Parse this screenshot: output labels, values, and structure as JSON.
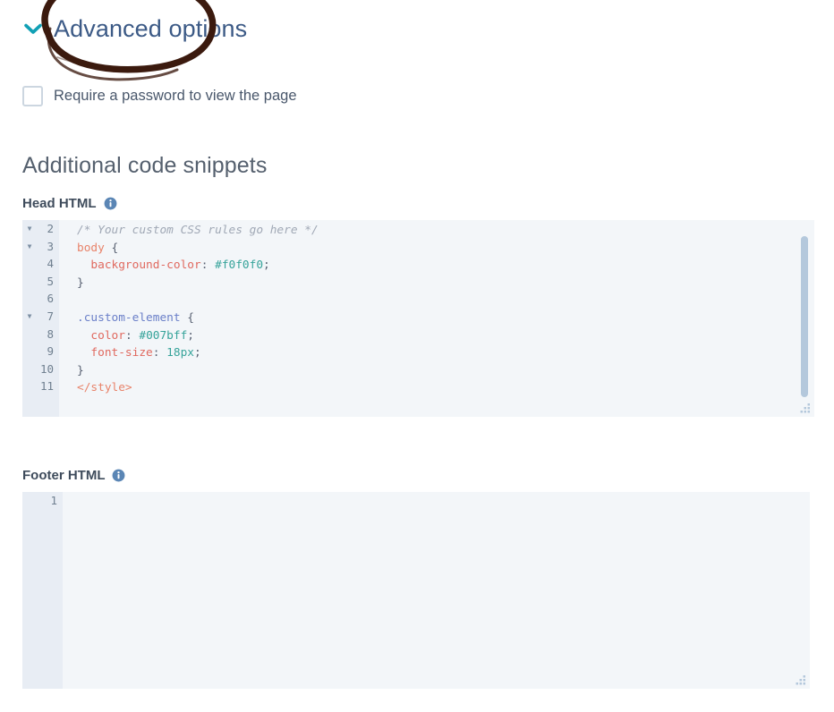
{
  "advanced_section": {
    "chevron_icon": "chevron-down-icon",
    "title": "Advanced options",
    "title_color": "#3c5a86",
    "chevron_color": "#11a0b5",
    "annotation": {
      "icon": "hand-drawn-circle-annotation",
      "color": "#3b1a0e"
    },
    "checkbox": {
      "label": "Require a password to view the page",
      "checked": false
    }
  },
  "snippets_section": {
    "title": "Additional code snippets",
    "fields": [
      {
        "label": "Head HTML",
        "info_icon": "info-circle-icon",
        "editor": {
          "first_line_number": 2,
          "has_scrollbar": true,
          "has_resize_grip": true,
          "lines": [
            {
              "number": 2,
              "foldable": true,
              "tokens": [
                {
                  "t": "comment",
                  "s": "/* Your custom CSS rules go here */"
                }
              ]
            },
            {
              "number": 3,
              "foldable": true,
              "tokens": [
                {
                  "t": "tag",
                  "s": "body"
                },
                {
                  "t": "punct",
                  "s": " {"
                }
              ]
            },
            {
              "number": 4,
              "foldable": false,
              "tokens": [
                {
                  "t": "prop",
                  "s": "  background-color"
                },
                {
                  "t": "punct",
                  "s": ": "
                },
                {
                  "t": "value",
                  "s": "#f0f0f0"
                },
                {
                  "t": "punct",
                  "s": ";"
                }
              ]
            },
            {
              "number": 5,
              "foldable": false,
              "tokens": [
                {
                  "t": "punct",
                  "s": "}"
                }
              ]
            },
            {
              "number": 6,
              "foldable": false,
              "tokens": [
                {
                  "t": "punct",
                  "s": ""
                }
              ]
            },
            {
              "number": 7,
              "foldable": true,
              "tokens": [
                {
                  "t": "selector",
                  "s": ".custom-element"
                },
                {
                  "t": "punct",
                  "s": " {"
                }
              ]
            },
            {
              "number": 8,
              "foldable": false,
              "tokens": [
                {
                  "t": "prop",
                  "s": "  color"
                },
                {
                  "t": "punct",
                  "s": ": "
                },
                {
                  "t": "value",
                  "s": "#007bff"
                },
                {
                  "t": "punct",
                  "s": ";"
                }
              ]
            },
            {
              "number": 9,
              "foldable": false,
              "tokens": [
                {
                  "t": "prop",
                  "s": "  font-size"
                },
                {
                  "t": "punct",
                  "s": ": "
                },
                {
                  "t": "value",
                  "s": "18px"
                },
                {
                  "t": "punct",
                  "s": ";"
                }
              ]
            },
            {
              "number": 10,
              "foldable": false,
              "tokens": [
                {
                  "t": "punct",
                  "s": "}"
                }
              ]
            },
            {
              "number": 11,
              "foldable": false,
              "tokens": [
                {
                  "t": "tag",
                  "s": "</style>"
                }
              ]
            }
          ]
        }
      },
      {
        "label": "Footer HTML",
        "info_icon": "info-circle-icon",
        "editor": {
          "first_line_number": 1,
          "has_scrollbar": false,
          "has_resize_grip": true,
          "lines": [
            {
              "number": 1,
              "foldable": false,
              "tokens": [
                {
                  "t": "punct",
                  "s": ""
                }
              ]
            }
          ]
        }
      }
    ]
  },
  "theme": {
    "editor_bg": "#f3f6f9",
    "gutter_bg": "#e8edf4",
    "scrollbar": "#b4c8dc",
    "info_icon_color": "#5b86b5"
  }
}
